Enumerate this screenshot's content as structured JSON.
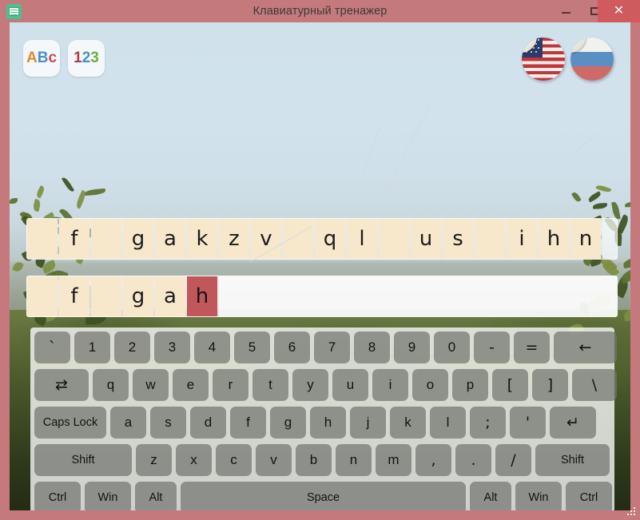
{
  "window": {
    "title": "Клавиатурный тренажер",
    "app_icon": "keyboard-trainer-icon",
    "minimize_label": "–",
    "maximize_label": "□",
    "close_label": "✕",
    "titlebar_color": "#c4797c",
    "close_color": "#d05b5f"
  },
  "toolbar": {
    "letters_mode": {
      "label": "ABc",
      "chars": [
        "A",
        "B",
        "c"
      ],
      "colors": [
        "#e08a33",
        "#4a90c8",
        "#cc4b4b"
      ]
    },
    "numbers_mode": {
      "label": "123",
      "chars": [
        "1",
        "2",
        "3"
      ],
      "colors": [
        "#b03a4a",
        "#4a90c8",
        "#6fae3a"
      ]
    }
  },
  "languages": [
    {
      "name": "english-flag",
      "label": "English (US)"
    },
    {
      "name": "russian-flag",
      "label": "Русский"
    }
  ],
  "exercise": {
    "target_row_name": "target-text-row",
    "typed_row_name": "typed-text-row",
    "target_cells": [
      {
        "char": "",
        "state": "blank"
      },
      {
        "char": "f",
        "state": "normal"
      },
      {
        "char": "",
        "state": "blank"
      },
      {
        "char": "g",
        "state": "normal"
      },
      {
        "char": "a",
        "state": "normal"
      },
      {
        "char": "k",
        "state": "normal"
      },
      {
        "char": "z",
        "state": "normal"
      },
      {
        "char": "v",
        "state": "normal"
      },
      {
        "char": "",
        "state": "blank"
      },
      {
        "char": "q",
        "state": "normal"
      },
      {
        "char": "l",
        "state": "normal"
      },
      {
        "char": "",
        "state": "blank"
      },
      {
        "char": "u",
        "state": "normal"
      },
      {
        "char": "s",
        "state": "normal"
      },
      {
        "char": "",
        "state": "blank"
      },
      {
        "char": "i",
        "state": "normal"
      },
      {
        "char": "h",
        "state": "normal"
      },
      {
        "char": "n",
        "state": "normal"
      }
    ],
    "typed_cells": [
      {
        "char": "",
        "state": "blank"
      },
      {
        "char": "f",
        "state": "normal"
      },
      {
        "char": "",
        "state": "blank"
      },
      {
        "char": "g",
        "state": "normal"
      },
      {
        "char": "a",
        "state": "normal"
      },
      {
        "char": "h",
        "state": "error"
      }
    ],
    "target_text": " f gakzv ql us ihn",
    "typed_text": " f gah"
  },
  "keyboard": {
    "name": "on-screen-keyboard",
    "rows": [
      [
        {
          "label": "`",
          "name": "key-backtick",
          "cls": "sym"
        },
        {
          "label": "1",
          "name": "key-1"
        },
        {
          "label": "2",
          "name": "key-2"
        },
        {
          "label": "3",
          "name": "key-3"
        },
        {
          "label": "4",
          "name": "key-4"
        },
        {
          "label": "5",
          "name": "key-5"
        },
        {
          "label": "6",
          "name": "key-6"
        },
        {
          "label": "7",
          "name": "key-7"
        },
        {
          "label": "8",
          "name": "key-8"
        },
        {
          "label": "9",
          "name": "key-9"
        },
        {
          "label": "0",
          "name": "key-0"
        },
        {
          "label": "-",
          "name": "key-minus",
          "cls": "sym"
        },
        {
          "label": "=",
          "name": "key-equals",
          "cls": "sym"
        },
        {
          "label": "←",
          "name": "key-backspace",
          "cls": "sym w-backspace"
        }
      ],
      [
        {
          "label": "⇄",
          "name": "key-tab",
          "cls": "sym w-tab"
        },
        {
          "label": "q",
          "name": "key-q"
        },
        {
          "label": "w",
          "name": "key-w"
        },
        {
          "label": "e",
          "name": "key-e"
        },
        {
          "label": "r",
          "name": "key-r"
        },
        {
          "label": "t",
          "name": "key-t"
        },
        {
          "label": "y",
          "name": "key-y"
        },
        {
          "label": "u",
          "name": "key-u"
        },
        {
          "label": "i",
          "name": "key-i"
        },
        {
          "label": "o",
          "name": "key-o"
        },
        {
          "label": "p",
          "name": "key-p"
        },
        {
          "label": "[",
          "name": "key-bracket-left",
          "cls": "sym"
        },
        {
          "label": "]",
          "name": "key-bracket-right",
          "cls": "sym"
        },
        {
          "label": "\\",
          "name": "key-backslash",
          "cls": "sym w-backslash"
        }
      ],
      [
        {
          "label": "Caps Lock",
          "name": "key-caps-lock",
          "cls": "small w-caps"
        },
        {
          "label": "a",
          "name": "key-a"
        },
        {
          "label": "s",
          "name": "key-s"
        },
        {
          "label": "d",
          "name": "key-d"
        },
        {
          "label": "f",
          "name": "key-f"
        },
        {
          "label": "g",
          "name": "key-g"
        },
        {
          "label": "h",
          "name": "key-h"
        },
        {
          "label": "j",
          "name": "key-j"
        },
        {
          "label": "k",
          "name": "key-k"
        },
        {
          "label": "l",
          "name": "key-l"
        },
        {
          "label": ";",
          "name": "key-semicolon",
          "cls": "sym"
        },
        {
          "label": "'",
          "name": "key-apostrophe",
          "cls": "sym"
        },
        {
          "label": "↵",
          "name": "key-enter",
          "cls": "sym w-enter"
        }
      ],
      [
        {
          "label": "Shift",
          "name": "key-shift-left",
          "cls": "small w-shift-l"
        },
        {
          "label": "z",
          "name": "key-z"
        },
        {
          "label": "x",
          "name": "key-x"
        },
        {
          "label": "c",
          "name": "key-c"
        },
        {
          "label": "v",
          "name": "key-v"
        },
        {
          "label": "b",
          "name": "key-b"
        },
        {
          "label": "n",
          "name": "key-n"
        },
        {
          "label": "m",
          "name": "key-m"
        },
        {
          "label": ",",
          "name": "key-comma",
          "cls": "sym"
        },
        {
          "label": ".",
          "name": "key-period",
          "cls": "sym"
        },
        {
          "label": "/",
          "name": "key-slash",
          "cls": "sym"
        },
        {
          "label": "Shift",
          "name": "key-shift-right",
          "cls": "small w-shift-r"
        }
      ],
      [
        {
          "label": "Ctrl",
          "name": "key-ctrl-left",
          "cls": "small w-ctrl"
        },
        {
          "label": "Win",
          "name": "key-win-left",
          "cls": "small w-win"
        },
        {
          "label": "Alt",
          "name": "key-alt-left",
          "cls": "small w-alt"
        },
        {
          "label": "Space",
          "name": "key-space",
          "cls": "small w-space"
        },
        {
          "label": "Alt",
          "name": "key-alt-right",
          "cls": "small w-alt"
        },
        {
          "label": "Win",
          "name": "key-win-right",
          "cls": "small w-win"
        },
        {
          "label": "Ctrl",
          "name": "key-ctrl-right",
          "cls": "small w-ctrl"
        }
      ]
    ]
  }
}
